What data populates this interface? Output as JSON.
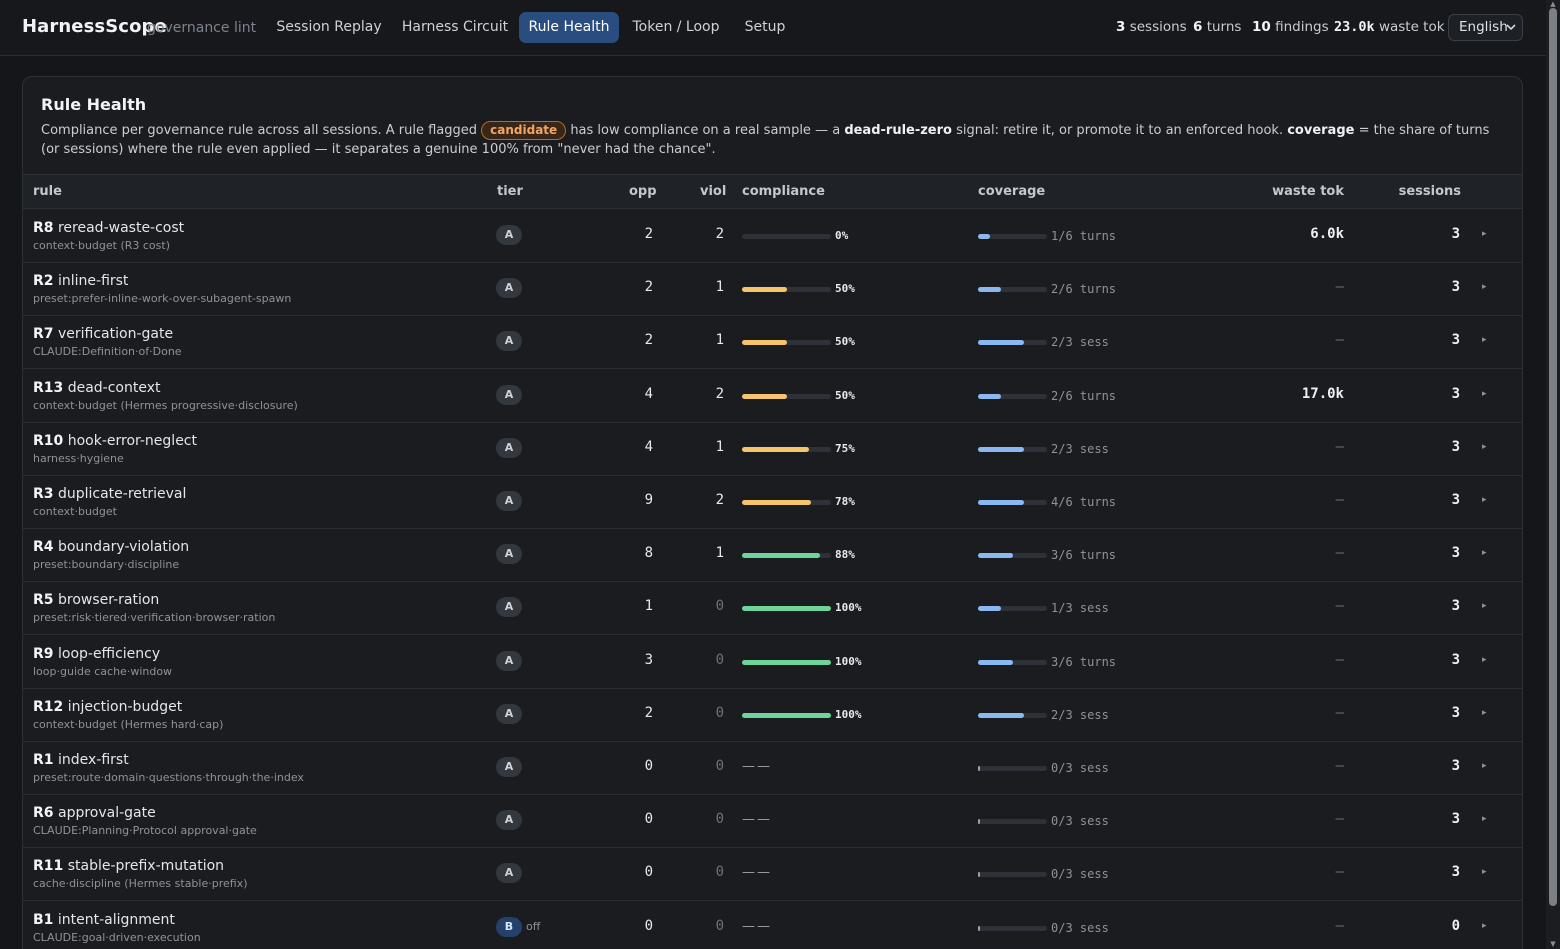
{
  "app": {
    "name": "HarnessScope",
    "subtitle": "governance lint"
  },
  "nav": [
    {
      "label": "Session Replay",
      "active": false
    },
    {
      "label": "Harness Circuit",
      "active": false
    },
    {
      "label": "Rule Health",
      "active": true
    },
    {
      "label": "Token / Loop",
      "active": false
    },
    {
      "label": "Setup",
      "active": false
    }
  ],
  "stats": {
    "sessions_value": "3",
    "sessions_label": "sessions",
    "turns_value": "6",
    "turns_label": "turns",
    "findings_value": "10",
    "findings_label": "findings",
    "waste_value": "23.0k",
    "waste_label": "waste tok"
  },
  "language": {
    "selected": "English"
  },
  "panel": {
    "title": "Rule Health",
    "desc_1": "Compliance per governance rule across all sessions. A rule flagged",
    "candidate": "candidate",
    "desc_2": "has low compliance on a real sample — a",
    "desc_dead": "dead-rule-zero",
    "desc_3": "signal: retire it, or promote it to an enforced hook.",
    "desc_cov": "coverage",
    "desc_4": "= the share of turns (or sessions) where the rule even applied — it separates a genuine 100% from \"never had the chance\"."
  },
  "columns": {
    "rule": "rule",
    "tier": "tier",
    "opp": "opp",
    "viol": "viol",
    "compliance": "compliance",
    "coverage": "coverage",
    "waste": "waste tok",
    "sessions": "sessions"
  },
  "colors": {
    "compliance_low": "#f6c56b",
    "compliance_high": "#6fd49a",
    "coverage": "#8bb8f0",
    "accent": "#2a4d80"
  },
  "rows": [
    {
      "id": "R8",
      "name": "reread-waste-cost",
      "source": "context·budget (R3 cost)",
      "tier": "A",
      "opp": "2",
      "viol": "2",
      "compliance": "0%",
      "compliance_fraction": 0.0,
      "coverage": "1/6 turns",
      "coverage_fraction": 0.1667,
      "waste": "6.0k",
      "sessions": "3"
    },
    {
      "id": "R2",
      "name": "inline-first",
      "source": "preset:prefer-inline-work-over-subagent-spawn",
      "tier": "A",
      "opp": "2",
      "viol": "1",
      "compliance": "50%",
      "compliance_fraction": 0.5,
      "coverage": "2/6 turns",
      "coverage_fraction": 0.3333,
      "waste": "–",
      "sessions": "3"
    },
    {
      "id": "R7",
      "name": "verification-gate",
      "source": "CLAUDE:Definition·of·Done",
      "tier": "A",
      "opp": "2",
      "viol": "1",
      "compliance": "50%",
      "compliance_fraction": 0.5,
      "coverage": "2/3 sess",
      "coverage_fraction": 0.6667,
      "waste": "–",
      "sessions": "3"
    },
    {
      "id": "R13",
      "name": "dead-context",
      "source": "context·budget (Hermes progressive·disclosure)",
      "tier": "A",
      "opp": "4",
      "viol": "2",
      "compliance": "50%",
      "compliance_fraction": 0.5,
      "coverage": "2/6 turns",
      "coverage_fraction": 0.3333,
      "waste": "17.0k",
      "sessions": "3"
    },
    {
      "id": "R10",
      "name": "hook-error-neglect",
      "source": "harness·hygiene",
      "tier": "A",
      "opp": "4",
      "viol": "1",
      "compliance": "75%",
      "compliance_fraction": 0.75,
      "coverage": "2/3 sess",
      "coverage_fraction": 0.6667,
      "waste": "–",
      "sessions": "3"
    },
    {
      "id": "R3",
      "name": "duplicate-retrieval",
      "source": "context·budget",
      "tier": "A",
      "opp": "9",
      "viol": "2",
      "compliance": "78%",
      "compliance_fraction": 0.78,
      "coverage": "4/6 turns",
      "coverage_fraction": 0.6667,
      "waste": "–",
      "sessions": "3"
    },
    {
      "id": "R4",
      "name": "boundary-violation",
      "source": "preset:boundary·discipline",
      "tier": "A",
      "opp": "8",
      "viol": "1",
      "compliance": "88%",
      "compliance_fraction": 0.88,
      "coverage": "3/6 turns",
      "coverage_fraction": 0.5,
      "waste": "–",
      "sessions": "3"
    },
    {
      "id": "R5",
      "name": "browser-ration",
      "source": "preset:risk·tiered·verification·browser·ration",
      "tier": "A",
      "opp": "1",
      "viol": "0",
      "compliance": "100%",
      "compliance_fraction": 1.0,
      "coverage": "1/3 sess",
      "coverage_fraction": 0.3333,
      "waste": "–",
      "sessions": "3"
    },
    {
      "id": "R9",
      "name": "loop-efficiency",
      "source": "loop·guide cache·window",
      "tier": "A",
      "opp": "3",
      "viol": "0",
      "compliance": "100%",
      "compliance_fraction": 1.0,
      "coverage": "3/6 turns",
      "coverage_fraction": 0.5,
      "waste": "–",
      "sessions": "3"
    },
    {
      "id": "R12",
      "name": "injection-budget",
      "source": "context·budget (Hermes hard·cap)",
      "tier": "A",
      "opp": "2",
      "viol": "0",
      "compliance": "100%",
      "compliance_fraction": 1.0,
      "coverage": "2/3 sess",
      "coverage_fraction": 0.6667,
      "waste": "–",
      "sessions": "3"
    },
    {
      "id": "R1",
      "name": "index-first",
      "source": "preset:route·domain·questions·through·the·index",
      "tier": "A",
      "opp": "0",
      "viol": "0",
      "compliance": "—",
      "compliance_fraction": null,
      "coverage": "0/3 sess",
      "coverage_fraction": 0.0,
      "waste": "–",
      "sessions": "3"
    },
    {
      "id": "R6",
      "name": "approval-gate",
      "source": "CLAUDE:Planning·Protocol approval·gate",
      "tier": "A",
      "opp": "0",
      "viol": "0",
      "compliance": "—",
      "compliance_fraction": null,
      "coverage": "0/3 sess",
      "coverage_fraction": 0.0,
      "waste": "–",
      "sessions": "3"
    },
    {
      "id": "R11",
      "name": "stable-prefix-mutation",
      "source": "cache·discipline (Hermes stable·prefix)",
      "tier": "A",
      "opp": "0",
      "viol": "0",
      "compliance": "—",
      "compliance_fraction": null,
      "coverage": "0/3 sess",
      "coverage_fraction": 0.0,
      "waste": "–",
      "sessions": "3"
    },
    {
      "id": "B1",
      "name": "intent-alignment",
      "source": "CLAUDE:goal·driven·execution",
      "tier": "B",
      "tier_note": "off",
      "opp": "0",
      "viol": "0",
      "compliance": "—",
      "compliance_fraction": null,
      "coverage": "0/3 sess",
      "coverage_fraction": 0.0,
      "waste": "–",
      "sessions": "0"
    }
  ]
}
